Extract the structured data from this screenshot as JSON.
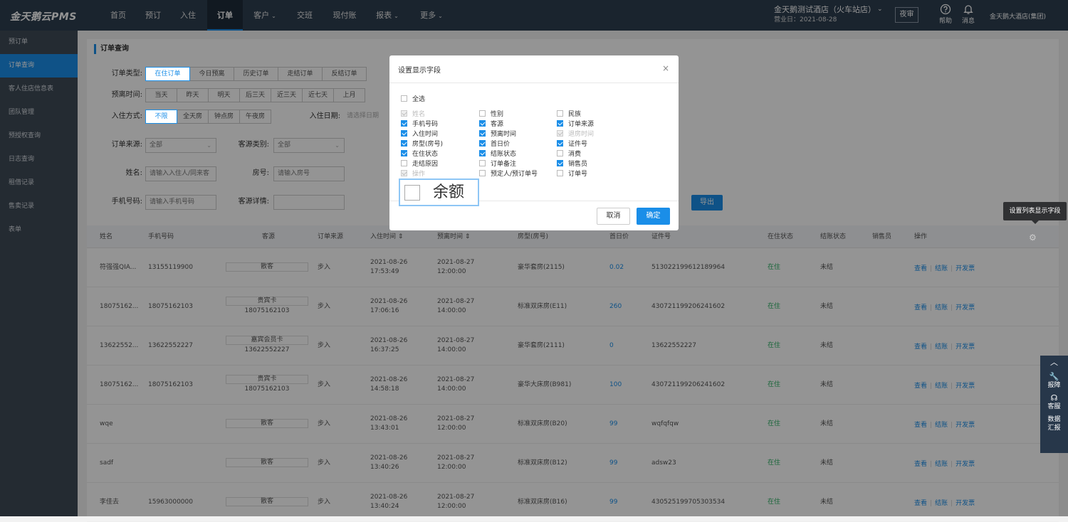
{
  "app": {
    "logo": "金天鹅云PMS"
  },
  "nav": [
    {
      "label": "首页"
    },
    {
      "label": "预订"
    },
    {
      "label": "入住"
    },
    {
      "label": "订单",
      "active": true
    },
    {
      "label": "客户",
      "dropdown": true
    },
    {
      "label": "交班"
    },
    {
      "label": "现付账"
    },
    {
      "label": "报表",
      "dropdown": true
    },
    {
      "label": "更多",
      "dropdown": true
    }
  ],
  "header": {
    "hotel_name": "金天鹅测试酒店（火车站店）",
    "business_day": "营业日：2021-08-28",
    "night_audit": "夜审",
    "help": "帮助",
    "messages": "消息",
    "group": "金天鹅大酒店(集团)"
  },
  "sidebar": [
    {
      "label": "预订单"
    },
    {
      "label": "订单查询",
      "active": true
    },
    {
      "label": "客人住店信息表"
    },
    {
      "label": "团队管理"
    },
    {
      "label": "预授权查询"
    },
    {
      "label": "日志查询"
    },
    {
      "label": "租借记录"
    },
    {
      "label": "售卖记录"
    },
    {
      "label": "表单"
    }
  ],
  "page": {
    "title": "订单查询"
  },
  "filters": {
    "order_type_label": "订单类型:",
    "order_types": [
      "在住订单",
      "今日预离",
      "历史订单",
      "走结订单",
      "反结订单"
    ],
    "leave_time_label": "预离时间:",
    "leave_times": [
      "当天",
      "昨天",
      "明天",
      "后三天",
      "近三天",
      "近七天",
      "上月"
    ],
    "checkin_mode_label": "入住方式:",
    "checkin_modes": [
      "不限",
      "全天房",
      "钟点房",
      "午夜房"
    ],
    "checkin_date_label": "入住日期:",
    "checkin_date_placeholder": "请选择日期",
    "order_source_label": "订单来源:",
    "order_source_value": "全部",
    "guest_source_label": "客源类别:",
    "guest_source_value": "全部",
    "name_label": "姓名:",
    "name_placeholder": "请输入入住人/同来客",
    "room_label": "房号:",
    "room_placeholder": "请输入房号",
    "phone_label": "手机号码:",
    "phone_placeholder": "请输入手机号码",
    "guest_detail_label": "客源详情:",
    "export": "导出"
  },
  "table": {
    "headers": [
      "姓名",
      "手机号码",
      "客源",
      "订单来源",
      "入住时间 ⇕",
      "预离时间 ⇕",
      "房型(房号)",
      "首日价",
      "证件号",
      "在住状态",
      "结账状态",
      "销售员",
      "操作"
    ],
    "rows": [
      {
        "name": "符强强QIA...",
        "phone": "13155119900",
        "source": "散客",
        "source_sub": "",
        "origin": "步入",
        "in_date": "2021-08-26",
        "in_time": "17:53:49",
        "out_date": "2021-08-27",
        "out_time": "12:00:00",
        "room": "豪华套房(2115)",
        "price": "0.02",
        "id": "513022199612189964",
        "status": "在住",
        "bill": "未结"
      },
      {
        "name": "18075162...",
        "phone": "18075162103",
        "source": "贵宾卡",
        "source_sub": "18075162103",
        "origin": "步入",
        "in_date": "2021-08-26",
        "in_time": "17:06:16",
        "out_date": "2021-08-27",
        "out_time": "14:00:00",
        "room": "标准双床房(E11)",
        "price": "260",
        "id": "430721199206241602",
        "status": "在住",
        "bill": "未结"
      },
      {
        "name": "13622552...",
        "phone": "13622552227",
        "source": "嘉宾会员卡",
        "source_sub": "13622552227",
        "origin": "步入",
        "in_date": "2021-08-26",
        "in_time": "16:37:25",
        "out_date": "2021-08-27",
        "out_time": "14:00:00",
        "room": "豪华套房(2111)",
        "price": "0",
        "id": "13622552227",
        "status": "在住",
        "bill": "未结"
      },
      {
        "name": "18075162...",
        "phone": "18075162103",
        "source": "贵宾卡",
        "source_sub": "18075162103",
        "origin": "步入",
        "in_date": "2021-08-26",
        "in_time": "14:58:18",
        "out_date": "2021-08-27",
        "out_time": "14:00:00",
        "room": "豪华大床房(B981)",
        "price": "100",
        "id": "430721199206241602",
        "status": "在住",
        "bill": "未结"
      },
      {
        "name": "wqe",
        "phone": "",
        "source": "散客",
        "source_sub": "",
        "origin": "步入",
        "in_date": "2021-08-26",
        "in_time": "13:43:01",
        "out_date": "2021-08-27",
        "out_time": "12:00:00",
        "room": "标准双床房(B20)",
        "price": "99",
        "id": "wqfqfqw",
        "status": "在住",
        "bill": "未结"
      },
      {
        "name": "sadf",
        "phone": "",
        "source": "散客",
        "source_sub": "",
        "origin": "步入",
        "in_date": "2021-08-26",
        "in_time": "13:40:26",
        "out_date": "2021-08-27",
        "out_time": "12:00:00",
        "room": "标准双床房(B12)",
        "price": "99",
        "id": "adsw23",
        "status": "在住",
        "bill": "未结"
      },
      {
        "name": "李佳去",
        "phone": "15963000000",
        "source": "散客",
        "source_sub": "",
        "origin": "步入",
        "in_date": "2021-08-26",
        "in_time": "13:40:24",
        "out_date": "2021-08-27",
        "out_time": "12:00:00",
        "room": "标准双床房(B16)",
        "price": "99",
        "id": "430525199705303534",
        "status": "在住",
        "bill": "未结"
      }
    ],
    "actions": [
      "查看",
      "结账",
      "开发票"
    ]
  },
  "tooltip": "设置列表显示字段",
  "right_panel": {
    "report": "报障",
    "service": "客服",
    "data": "数据",
    "data2": "汇报"
  },
  "modal": {
    "title": "设置显示字段",
    "select_all": "全选",
    "fields": [
      {
        "label": "姓名",
        "state": "disabled"
      },
      {
        "label": "性别",
        "state": "off"
      },
      {
        "label": "民族",
        "state": "off"
      },
      {
        "label": "手机号码",
        "state": "on"
      },
      {
        "label": "客源",
        "state": "on"
      },
      {
        "label": "订单来源",
        "state": "on"
      },
      {
        "label": "入住时间",
        "state": "on"
      },
      {
        "label": "预离时间",
        "state": "on"
      },
      {
        "label": "退房时间",
        "state": "disabled"
      },
      {
        "label": "房型(房号)",
        "state": "on"
      },
      {
        "label": "首日价",
        "state": "on"
      },
      {
        "label": "证件号",
        "state": "on"
      },
      {
        "label": "在住状态",
        "state": "on"
      },
      {
        "label": "结账状态",
        "state": "on"
      },
      {
        "label": "消费",
        "state": "off"
      },
      {
        "label": "走结原因",
        "state": "off"
      },
      {
        "label": "订单备注",
        "state": "off"
      },
      {
        "label": "销售员",
        "state": "on"
      },
      {
        "label": "操作",
        "state": "disabled"
      },
      {
        "label": "预定人/预订单号",
        "state": "off"
      },
      {
        "label": "订单号",
        "state": "off"
      }
    ],
    "balance": "余额",
    "cancel": "取消",
    "ok": "确定"
  },
  "colors": {
    "primary": "#1a8ee8",
    "topbar": "#2d3e50",
    "sidebar": "#3e4a57"
  }
}
